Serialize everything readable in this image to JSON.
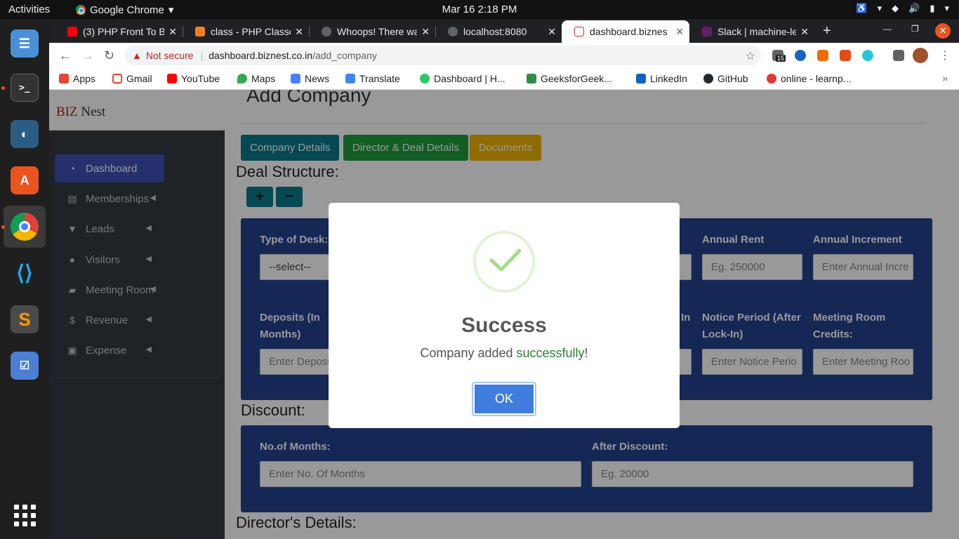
{
  "os": {
    "activities": "Activities",
    "app_name": "Google Chrome",
    "clock": "Mar 16  2:18 PM"
  },
  "browser": {
    "tabs": [
      {
        "title": "(3) PHP Front To B",
        "active": false
      },
      {
        "title": "class - PHP Classe",
        "active": false
      },
      {
        "title": "Whoops! There wa",
        "active": false
      },
      {
        "title": "localhost:8080",
        "active": false
      },
      {
        "title": "dashboard.biznes",
        "active": true
      },
      {
        "title": "Slack | machine-le",
        "active": false
      }
    ],
    "security_label": "Not secure",
    "url_host": "dashboard.biznest.co.in",
    "url_path": "/add_company",
    "extension_badge": "15",
    "bookmarks": [
      "Apps",
      "Gmail",
      "YouTube",
      "Maps",
      "News",
      "Translate",
      "Dashboard | H...",
      "GeeksforGeek...",
      "LinkedIn",
      "GitHub",
      "online - learnp..."
    ],
    "bookmarks_more": "»"
  },
  "sidebar": {
    "brand_a": "BIZ",
    "brand_b": " Nest",
    "items": [
      {
        "label": "Dashboard"
      },
      {
        "label": "Memberships"
      },
      {
        "label": "Leads"
      },
      {
        "label": "Visitors"
      },
      {
        "label": "Meeting Room"
      },
      {
        "label": "Revenue"
      },
      {
        "label": "Expense"
      }
    ]
  },
  "main": {
    "page_title": "Add Company",
    "tabs": [
      "Company Details",
      "Director & Deal Details",
      "Documents"
    ],
    "deal_heading": "Deal Structure:",
    "deal": {
      "type_label": "Type of Desk:",
      "type_value": "--select--",
      "annual_rent_label": "Annual Rent",
      "annual_rent_ph": "Eg. 250000",
      "annual_increment_label": "Annual Increment",
      "annual_increment_ph": "Enter Annual Incre",
      "deposits_label": "Deposits (In Months)",
      "deposits_ph": "Enter Deposi",
      "lockin_label_fragment": "In",
      "notice_label": "Notice Period (After Lock-In)",
      "notice_ph": "Enter Notice Perio",
      "meeting_label": "Meeting Room Credits:",
      "meeting_ph": "Enter Meeting Roo"
    },
    "discount_heading": "Discount:",
    "discount": {
      "months_label": "No.of Months:",
      "months_ph": "Enter No. Of Months",
      "after_label": "After Discount:",
      "after_ph": "Eg. 20000"
    },
    "director_heading": "Director's Details:"
  },
  "modal": {
    "title": "Success",
    "text_before": "Company added ",
    "text_highlight": "successfully",
    "text_after": "!",
    "ok_label": "OK"
  },
  "colors": {
    "accent": "#3f51b5",
    "panel": "#23418e",
    "tab_teal": "#0a7b8a",
    "tab_green": "#1f9d3f",
    "tab_yellow": "#f0b400",
    "ok_button": "#3f7dde",
    "success_check": "#a5dc86"
  }
}
